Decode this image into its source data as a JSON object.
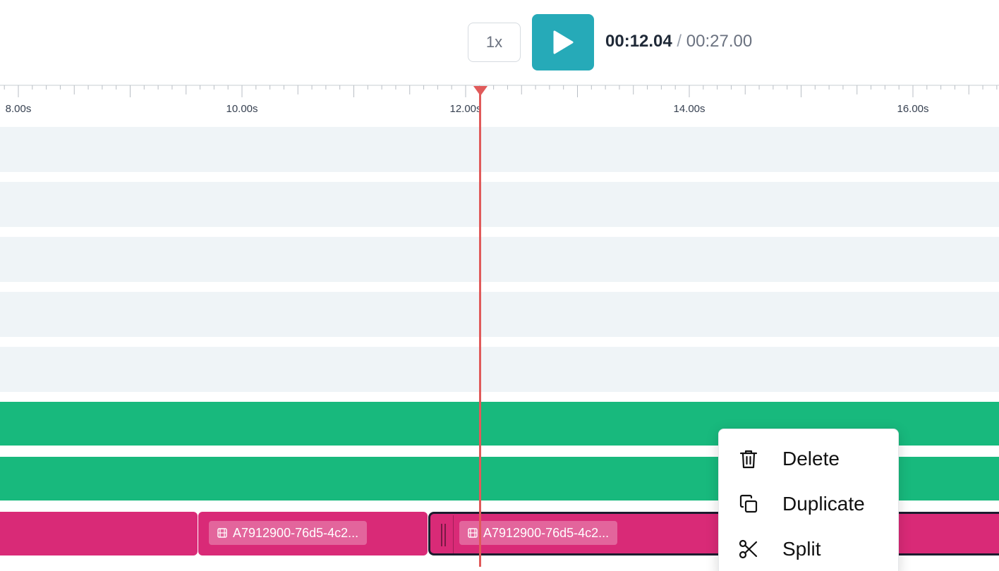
{
  "toolbar": {
    "speed_label": "1x",
    "play_icon": "play-icon",
    "current_time": "00:12.04",
    "separator": "/",
    "total_time": "00:27.00"
  },
  "ruler": {
    "labels": [
      "8.00s",
      "10.00s",
      "12.00s",
      "14.00s",
      "16.00s"
    ]
  },
  "timeline": {
    "playhead_time": "00:12.04",
    "clips": [
      {
        "label": "A7912900-76d5-4c2...",
        "icon": "film-icon"
      },
      {
        "label": "A7912900-76d5-4c2...",
        "icon": "film-icon"
      }
    ]
  },
  "context_menu": {
    "items": [
      {
        "label": "Delete",
        "icon": "trash-icon"
      },
      {
        "label": "Duplicate",
        "icon": "copy-icon"
      },
      {
        "label": "Split",
        "icon": "scissors-icon"
      }
    ]
  },
  "colors": {
    "accent": "#26aab8",
    "playhead": "#e05a5a",
    "clip": "#d92a77",
    "audio_track": "#18b97d",
    "empty_track": "#eff4f7"
  }
}
